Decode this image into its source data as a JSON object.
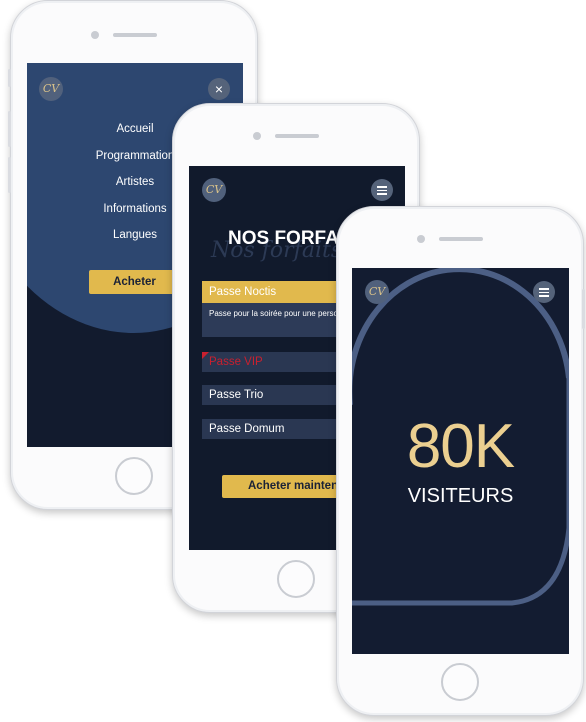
{
  "menu_screen": {
    "logo_text": "CV",
    "close_glyph": "×",
    "nav_items": [
      "Accueil",
      "Programmation",
      "Artistes",
      "Informations",
      "Langues"
    ],
    "cta_label": "Acheter"
  },
  "passes_screen": {
    "logo_text": "CV",
    "title": "NOS FORFAITS",
    "script_title": "Nos forfaits",
    "passes": [
      {
        "label": "Passe Noctis",
        "description": "Passe pour la soirée pour une personne seulement."
      },
      {
        "label": "Passe VIP"
      },
      {
        "label": "Passe Trio"
      },
      {
        "label": "Passe Domum"
      }
    ],
    "cta_label": "Acheter maintenant"
  },
  "stats_screen": {
    "logo_text": "CV",
    "number": "80K",
    "caption": "VISITEURS"
  },
  "colors": {
    "navy": "#121b2e",
    "wave_blue": "#2d4770",
    "gold": "#e1b94d",
    "vip_red": "#c8202f"
  },
  "icons": [
    "logo-icon",
    "close-icon",
    "hamburger-icon"
  ]
}
